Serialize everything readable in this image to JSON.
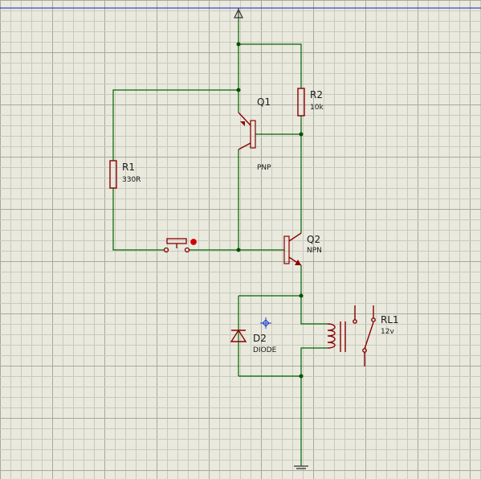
{
  "components": {
    "r1": {
      "ref": "R1",
      "value": "330R"
    },
    "r2": {
      "ref": "R2",
      "value": "10k"
    },
    "q1": {
      "ref": "Q1",
      "value": "PNP"
    },
    "q2": {
      "ref": "Q2",
      "value": "NPN"
    },
    "d2": {
      "ref": "D2",
      "value": "DIODE"
    },
    "rl1": {
      "ref": "RL1",
      "value": "12v"
    }
  },
  "colors": {
    "background": "#e9e9de",
    "grid_minor": "#c9c9bc",
    "grid_major": "#a8a89c",
    "wire": "#006400",
    "component": "#8b0000",
    "junction": "#005000",
    "terminal": "#333333",
    "power_line": "#1c1cc8",
    "switch_indicator": "#d00000",
    "cursor": "#2040d0"
  },
  "symbols": {
    "power": "power-arrow",
    "ground": "ground",
    "switch": "push-button",
    "cursor": "crosshair"
  }
}
